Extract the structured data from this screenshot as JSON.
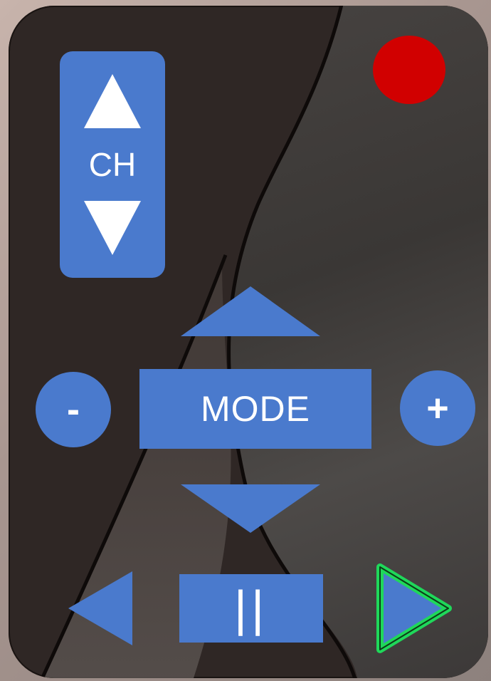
{
  "remote": {
    "channel": {
      "label": "CH",
      "up_icon": "triangle-up-icon",
      "down_icon": "triangle-down-icon"
    },
    "record": {
      "icon": "record-dot-icon",
      "color": "#d10000"
    },
    "mode": {
      "label": "MODE",
      "up_icon": "triangle-up-icon",
      "down_icon": "triangle-down-icon"
    },
    "minus_label": "-",
    "plus_label": "+",
    "transport": {
      "rewind_icon": "triangle-left-icon",
      "pause_label": "||",
      "play_icon": "triangle-right-icon",
      "play_glow_color": "#1fd85a"
    },
    "colors": {
      "button": "#4a7acd",
      "body": "#2f2725",
      "record": "#d10000",
      "play_glow": "#1fd85a"
    }
  }
}
